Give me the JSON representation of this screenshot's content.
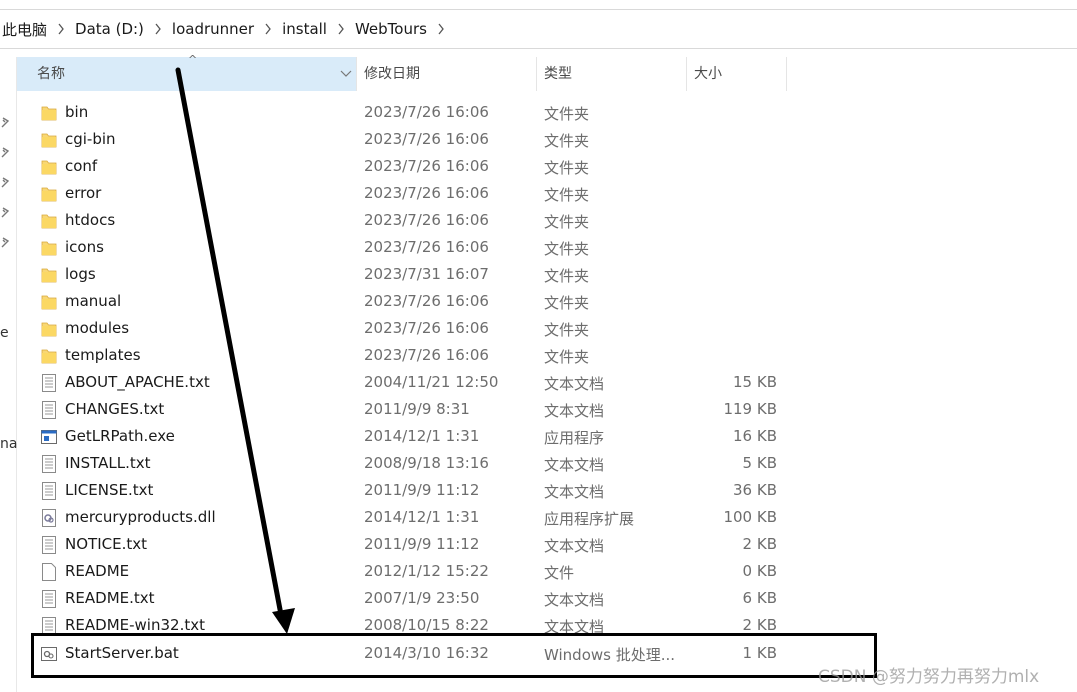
{
  "breadcrumb": [
    "此电脑",
    "Data (D:)",
    "loadrunner",
    "install",
    "WebTours"
  ],
  "nav_fragments": [
    "e",
    "na"
  ],
  "columns": {
    "name": "名称",
    "date": "修改日期",
    "type": "类型",
    "size": "大小"
  },
  "files": [
    {
      "name": "bin",
      "date": "2023/7/26 16:06",
      "type": "文件夹",
      "size": "",
      "icon": "folder-icon"
    },
    {
      "name": "cgi-bin",
      "date": "2023/7/26 16:06",
      "type": "文件夹",
      "size": "",
      "icon": "folder-icon"
    },
    {
      "name": "conf",
      "date": "2023/7/26 16:06",
      "type": "文件夹",
      "size": "",
      "icon": "folder-icon"
    },
    {
      "name": "error",
      "date": "2023/7/26 16:06",
      "type": "文件夹",
      "size": "",
      "icon": "folder-icon"
    },
    {
      "name": "htdocs",
      "date": "2023/7/26 16:06",
      "type": "文件夹",
      "size": "",
      "icon": "folder-icon"
    },
    {
      "name": "icons",
      "date": "2023/7/26 16:06",
      "type": "文件夹",
      "size": "",
      "icon": "folder-icon"
    },
    {
      "name": "logs",
      "date": "2023/7/31 16:07",
      "type": "文件夹",
      "size": "",
      "icon": "folder-icon"
    },
    {
      "name": "manual",
      "date": "2023/7/26 16:06",
      "type": "文件夹",
      "size": "",
      "icon": "folder-icon"
    },
    {
      "name": "modules",
      "date": "2023/7/26 16:06",
      "type": "文件夹",
      "size": "",
      "icon": "folder-icon"
    },
    {
      "name": "templates",
      "date": "2023/7/26 16:06",
      "type": "文件夹",
      "size": "",
      "icon": "folder-icon"
    },
    {
      "name": "ABOUT_APACHE.txt",
      "date": "2004/11/21 12:50",
      "type": "文本文档",
      "size": "15 KB",
      "icon": "text-file-icon"
    },
    {
      "name": "CHANGES.txt",
      "date": "2011/9/9 8:31",
      "type": "文本文档",
      "size": "119 KB",
      "icon": "text-file-icon"
    },
    {
      "name": "GetLRPath.exe",
      "date": "2014/12/1 1:31",
      "type": "应用程序",
      "size": "16 KB",
      "icon": "exe-file-icon"
    },
    {
      "name": "INSTALL.txt",
      "date": "2008/9/18 13:16",
      "type": "文本文档",
      "size": "5 KB",
      "icon": "text-file-icon"
    },
    {
      "name": "LICENSE.txt",
      "date": "2011/9/9 11:12",
      "type": "文本文档",
      "size": "36 KB",
      "icon": "text-file-icon"
    },
    {
      "name": "mercuryproducts.dll",
      "date": "2014/12/1 1:31",
      "type": "应用程序扩展",
      "size": "100 KB",
      "icon": "dll-file-icon"
    },
    {
      "name": "NOTICE.txt",
      "date": "2011/9/9 11:12",
      "type": "文本文档",
      "size": "2 KB",
      "icon": "text-file-icon"
    },
    {
      "name": "README",
      "date": "2012/1/12 15:22",
      "type": "文件",
      "size": "0 KB",
      "icon": "blank-file-icon"
    },
    {
      "name": "README.txt",
      "date": "2007/1/9 23:50",
      "type": "文本文档",
      "size": "6 KB",
      "icon": "text-file-icon"
    },
    {
      "name": "README-win32.txt",
      "date": "2008/10/15 8:22",
      "type": "文本文档",
      "size": "2 KB",
      "icon": "text-file-icon"
    },
    {
      "name": "StartServer.bat",
      "date": "2014/3/10 16:32",
      "type": "Windows 批处理...",
      "size": "1 KB",
      "icon": "batch-file-icon"
    }
  ],
  "watermark": "CSDN @努力努力再努力mlx",
  "colors": {
    "header_selected": "#d9ebf9",
    "folder": "#f8d775",
    "annotation": "#000000"
  }
}
